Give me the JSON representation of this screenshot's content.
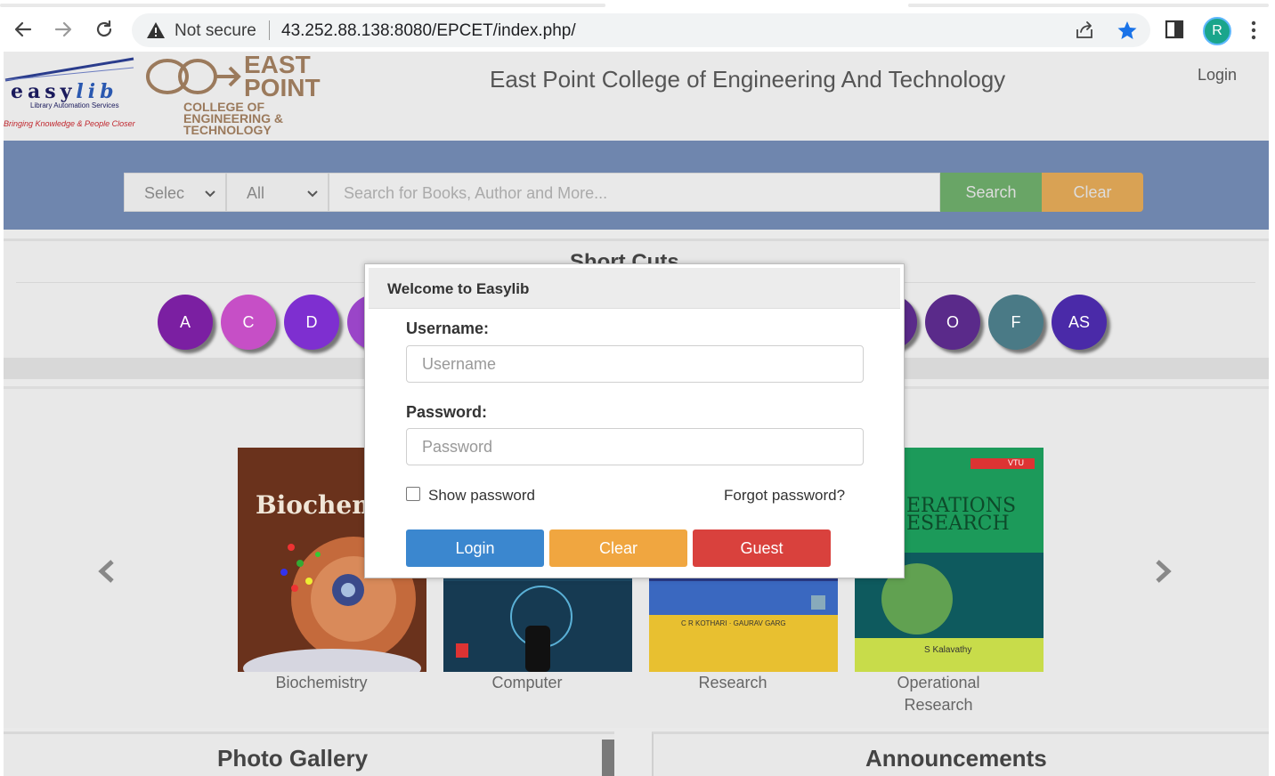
{
  "browser": {
    "security_label": "Not secure",
    "url": "43.252.88.138:8080/EPCET/index.php/",
    "profile_initial": "R",
    "colors": {
      "star": "#1a73e8",
      "profile": "#1aa58b"
    }
  },
  "header": {
    "easylib_logo": {
      "word_a": "easy",
      "word_b": "lib",
      "tagline": "Library Automation Services",
      "slogan": "Bringing Knowledge & People Closer"
    },
    "epcet_logo": {
      "line1": "EAST",
      "line2": "POINT",
      "sub1": "COLLEGE OF",
      "sub2": "ENGINEERING &",
      "sub3": "TECHNOLOGY"
    },
    "college_title": "East Point College of Engineering And Technology",
    "login_link": "Login"
  },
  "search": {
    "select1": "Selec",
    "select2": "All",
    "placeholder": "Search for Books, Author and More...",
    "search_button": "Search",
    "clear_button": "Clear"
  },
  "shortcuts": {
    "title": "Short Cuts",
    "letters": [
      {
        "label": "A",
        "color": "#7b1fa2"
      },
      {
        "label": "C",
        "color": "#c64fc6"
      },
      {
        "label": "D",
        "color": "#7e2fd0"
      },
      {
        "label": "O",
        "color": "#5a2a8a"
      },
      {
        "label": "F",
        "color": "#4a7a86"
      },
      {
        "label": "AS",
        "color": "#4a2aa8"
      }
    ]
  },
  "books": [
    {
      "title": "Biochemistry",
      "cover_text": "Biochemis"
    },
    {
      "title": "Computer"
    },
    {
      "title": "Research",
      "cover_text": "C R KOTHARI · GAURAV GARG"
    },
    {
      "title_line1": "Operational",
      "title_line2": "Research",
      "cover_text1": "ERATIONS",
      "cover_text2": "ESEARCH",
      "cover_author": "S Kalavathy",
      "cover_badge": "VTU"
    }
  ],
  "sections": {
    "gallery": "Photo Gallery",
    "announcements": "Announcements"
  },
  "modal": {
    "title": "Welcome to Easylib",
    "username_label": "Username:",
    "username_placeholder": "Username",
    "password_label": "Password:",
    "password_placeholder": "Password",
    "show_password": "Show password",
    "forgot_password": "Forgot password?",
    "login_button": "Login",
    "clear_button": "Clear",
    "guest_button": "Guest",
    "colors": {
      "login": "#3b87cf",
      "clear": "#f0a640",
      "guest": "#d9413d"
    }
  }
}
